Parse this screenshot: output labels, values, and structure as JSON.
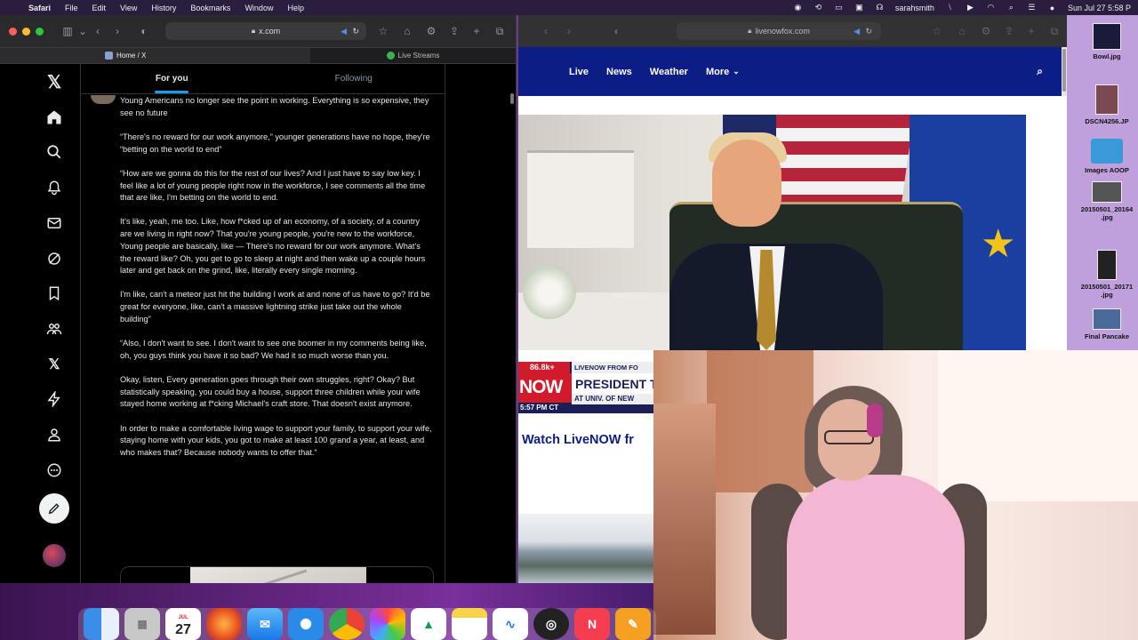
{
  "menubar": {
    "app": "Safari",
    "menus": [
      "File",
      "Edit",
      "View",
      "History",
      "Bookmarks",
      "Window",
      "Help"
    ],
    "user": "sarahsmith",
    "clock": "Sun Jul 27  5:58 P"
  },
  "left_window": {
    "url": "x.com",
    "tabs": [
      "Home / X",
      "Live Streams"
    ],
    "feed": {
      "tab_for_you": "For you",
      "tab_following": "Following",
      "paragraphs": [
        "Young Americans no longer see the point in working. Everything is so expensive, they see no future",
        "“There's no reward for our work anymore,” younger generations have no hope, they're “betting on the world to end”",
        "“How are we gonna do this for the rest of our lives? And I just have to say low key. I feel like a lot of young people right now in the workforce, I see comments all the time that are like, I'm betting on the world to end.",
        "It's like, yeah, me too. Like, how f*cked up of an economy, of a society, of a country are we living in right now? That you're young people, you're new to the workforce, Young people are basically, like — There's no reward for our work anymore. What's the reward like? Oh, you get to go to sleep at night and then wake up a couple hours later and get back on the grind, like, literally every single morning.",
        "I'm like, can't a meteor just hit the building I work at and none of us have to go? It'd be great for everyone, like, can't a massive lightning strike just take out the whole building\"",
        "“Also, I don't want to see. I don't want to see one boomer in my comments being like, oh, you guys think you have it so bad? We had it so much worse than you.",
        "Okay, listen, Every generation goes through their own struggles, right? Okay? But statistically speaking, you could buy a house, support three children while your wife stayed home working at f*cking Michael's craft store. That doesn't exist anymore.",
        "In order to make a comfortable living wage to support your family, to support your wife, staying home with your kids, you got to make at least 100 grand a year, at least, and who makes that? Because nobody wants to offer that.”"
      ]
    }
  },
  "right_window": {
    "url": "livenowfox.com",
    "nav": [
      "Live",
      "News",
      "Weather",
      "More"
    ],
    "ticker": {
      "viewers": "86.8k+",
      "top_line": "LIVENOW FROM FO",
      "now": "NOW",
      "headline": "PRESIDENT TRU",
      "time": "5:57 PM CT",
      "sub_line": "AT UNIV. OF NEW"
    },
    "watch_title": "Watch LiveNOW fr"
  },
  "desktop_icons": [
    {
      "label": "Bowl.jpg",
      "color": "#1a1a3a"
    },
    {
      "label": "DSCN4256.JP",
      "color": "#7a4a50"
    },
    {
      "label": "Images AOOP",
      "color": "#3a9ad9"
    },
    {
      "label": "20150501_20164 .jpg",
      "color": "#555"
    },
    {
      "label": "20150501_20171 .jpg",
      "color": "#222"
    },
    {
      "label": "Final Pancake",
      "color": "#4a6a9a"
    }
  ],
  "dock": {
    "calendar_month": "JUL",
    "calendar_day": "27"
  },
  "colors": {
    "x_accent": "#1d9bf0",
    "livenow_blue": "#0c1d86",
    "livenow_red": "#d11a2a"
  }
}
